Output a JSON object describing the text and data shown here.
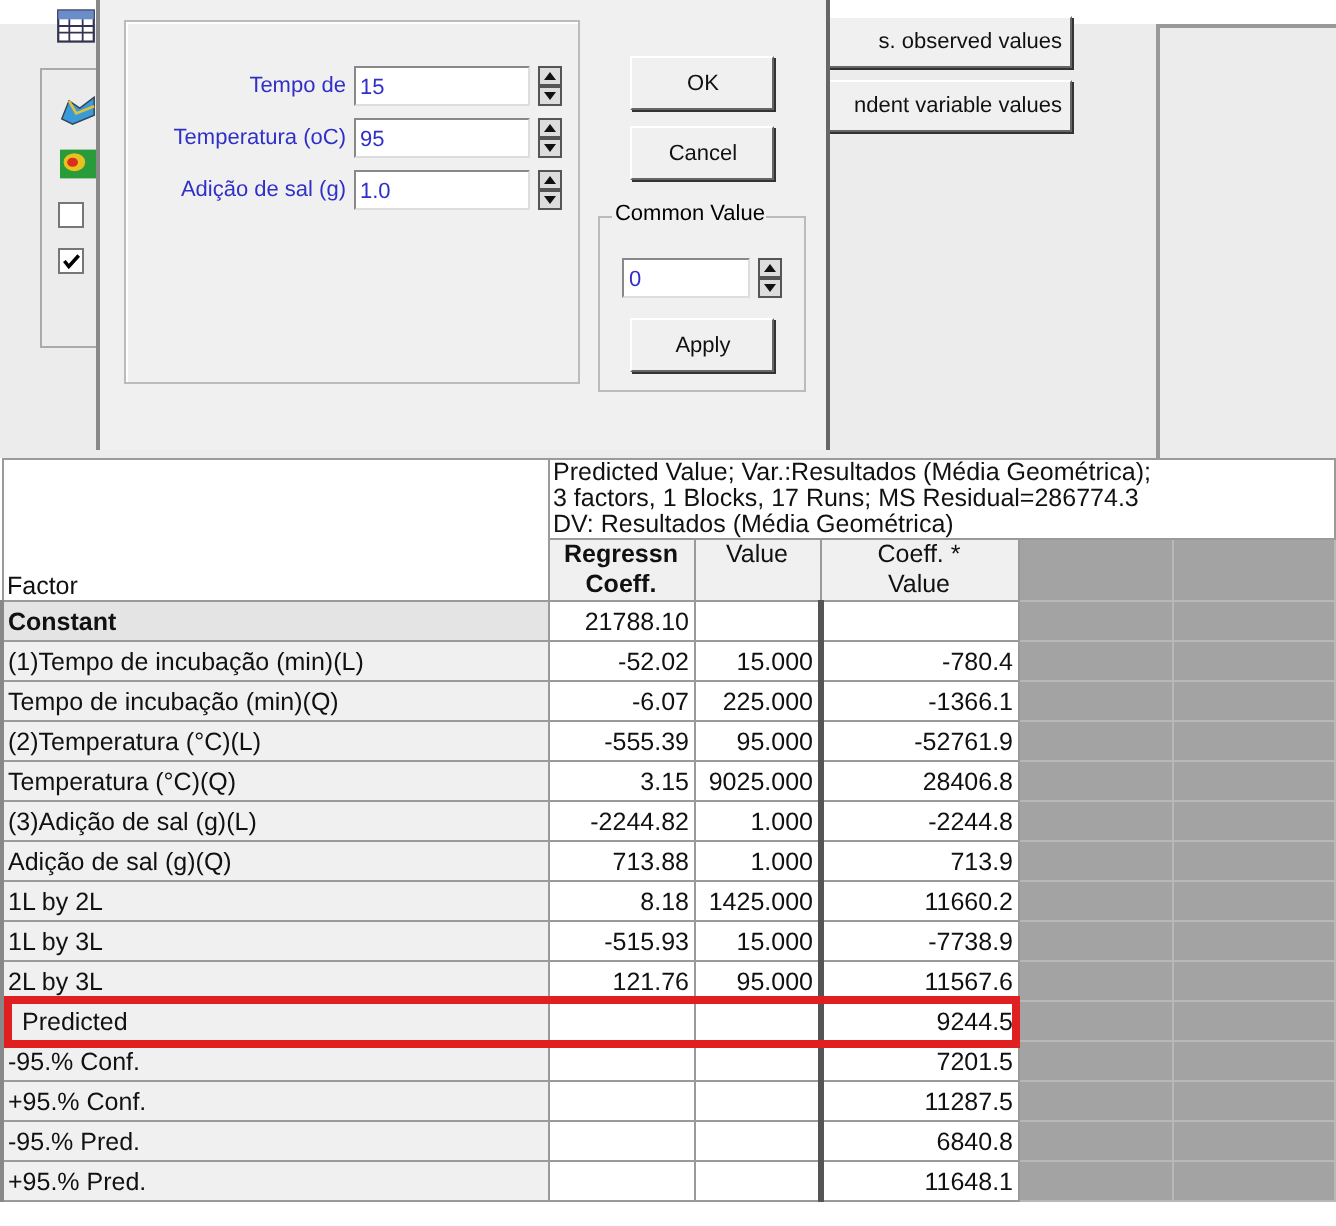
{
  "background": {
    "buttons": [
      "s. observed values",
      "ndent variable values"
    ],
    "checkboxes": [
      {
        "checked": false
      },
      {
        "checked": true
      }
    ]
  },
  "dialog": {
    "fields": [
      {
        "label": "Tempo de",
        "value": "15"
      },
      {
        "label": "Temperatura (oC)",
        "value": "95"
      },
      {
        "label": "Adição de sal (g)",
        "value": "1.0"
      }
    ],
    "ok": "OK",
    "cancel": "Cancel",
    "common_value": {
      "title": "Common Value",
      "value": "0",
      "apply": "Apply"
    }
  },
  "table": {
    "title_lines": [
      "Predicted Value; Var.:Resultados (Média Geométrica);",
      "3 factors, 1 Blocks, 17 Runs; MS Residual=286774.3",
      "DV: Resultados (Média Geométrica)"
    ],
    "row_header_title": "Factor",
    "columns": [
      {
        "lines": [
          "Regressn",
          "Coeff."
        ],
        "bold": true
      },
      {
        "lines": [
          "Value"
        ],
        "bold": false
      },
      {
        "lines": [
          "Coeff. *",
          "Value"
        ],
        "bold": false
      }
    ],
    "rows": [
      {
        "factor": "Constant",
        "bold": true,
        "highlighted": false,
        "cells": [
          "21788.10",
          null,
          null
        ]
      },
      {
        "factor": "(1)Tempo de incubação (min)(L)",
        "bold": false,
        "highlighted": false,
        "cells": [
          "-52.02",
          "15.000",
          "-780.4"
        ]
      },
      {
        "factor": "Tempo de incubação (min)(Q)",
        "bold": false,
        "highlighted": false,
        "cells": [
          "-6.07",
          "225.000",
          "-1366.1"
        ]
      },
      {
        "factor": "(2)Temperatura (°C)(L)",
        "bold": false,
        "highlighted": false,
        "cells": [
          "-555.39",
          "95.000",
          "-52761.9"
        ]
      },
      {
        "factor": "Temperatura (°C)(Q)",
        "bold": false,
        "highlighted": false,
        "cells": [
          "3.15",
          "9025.000",
          "28406.8"
        ]
      },
      {
        "factor": "(3)Adição de sal (g)(L)",
        "bold": false,
        "highlighted": false,
        "cells": [
          "-2244.82",
          "1.000",
          "-2244.8"
        ]
      },
      {
        "factor": "Adição de sal (g)(Q)",
        "bold": false,
        "highlighted": false,
        "cells": [
          "713.88",
          "1.000",
          "713.9"
        ]
      },
      {
        "factor": "1L by 2L",
        "bold": false,
        "highlighted": false,
        "cells": [
          "8.18",
          "1425.000",
          "11660.2"
        ]
      },
      {
        "factor": "1L by 3L",
        "bold": false,
        "highlighted": false,
        "cells": [
          "-515.93",
          "15.000",
          "-7738.9"
        ]
      },
      {
        "factor": "2L by 3L",
        "bold": false,
        "highlighted": false,
        "cells": [
          "121.76",
          "95.000",
          "11567.6"
        ]
      },
      {
        "factor": "Predicted",
        "bold": false,
        "highlighted": true,
        "cells": [
          null,
          null,
          "9244.5"
        ]
      },
      {
        "factor": "-95.% Conf.",
        "bold": false,
        "highlighted": false,
        "cells": [
          null,
          null,
          "7201.5"
        ]
      },
      {
        "factor": "+95.% Conf.",
        "bold": false,
        "highlighted": false,
        "cells": [
          null,
          null,
          "11287.5"
        ]
      },
      {
        "factor": "-95.% Pred.",
        "bold": false,
        "highlighted": false,
        "cells": [
          null,
          null,
          "6840.8"
        ]
      },
      {
        "factor": "+95.% Pred.",
        "bold": false,
        "highlighted": false,
        "cells": [
          null,
          null,
          "11648.1"
        ]
      }
    ]
  }
}
